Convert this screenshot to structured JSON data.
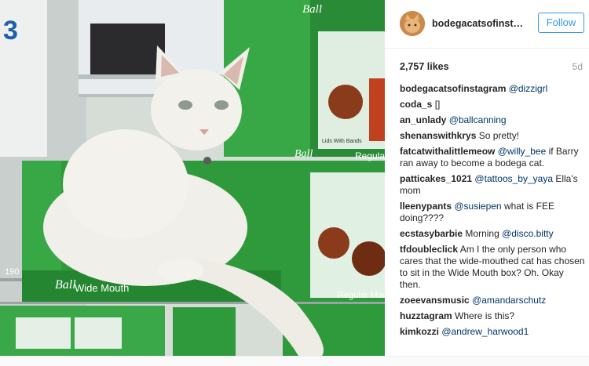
{
  "post": {
    "username": "bodegacatsofinstag...",
    "follow_label": "Follow",
    "likes": "2,757 likes",
    "time": "5d",
    "photo_text": {
      "box_brand": "Ball",
      "regular_mouth": "Regular Mouth",
      "wide_mouth": "Wide Mouth",
      "regular_short": "Regula",
      "lids_bands": "Lids With Bands",
      "price_tag": "190",
      "big_digit": "3"
    }
  },
  "comments": [
    {
      "author": "bodegacatsofinstagram",
      "mention": "@dizzigrl",
      "text": ""
    },
    {
      "author": "coda_s",
      "mention": "",
      "text": "[]"
    },
    {
      "author": "an_unlady",
      "mention": "@ballcanning",
      "text": ""
    },
    {
      "author": "shenanswithkrys",
      "mention": "",
      "text": "So pretty!"
    },
    {
      "author": "fatcatwithalittlemeow",
      "mention": "@willy_bee",
      "text": "if Barry ran away to become a bodega cat."
    },
    {
      "author": "patticakes_1021",
      "mention": "@tattoos_by_yaya",
      "text": "Ella's mom"
    },
    {
      "author": "lleenypants",
      "mention": "@susiepen",
      "text": "what is FEE doing????"
    },
    {
      "author": "ecstasybarbie",
      "mention": "",
      "text": "Morning ",
      "mention_after": "@disco.bitty"
    },
    {
      "author": "tfdoubleclick",
      "mention": "",
      "text": "Am I the only person who cares that the wide-mouthed cat has chosen to sit in the Wide Mouth box? Oh. Okay then."
    },
    {
      "author": "zoeevansmusic",
      "mention": "@amandarschutz",
      "text": ""
    },
    {
      "author": "huzztagram",
      "mention": "",
      "text": "Where is this?"
    },
    {
      "author": "kimkozzi",
      "mention": "@andrew_harwood1",
      "text": ""
    }
  ],
  "colors": {
    "accent": "#3897f0",
    "mention": "#003569",
    "box_green": "#2f9a3c",
    "cat": "#f1efe9"
  },
  "icons": {
    "avatar": "cat-avatar"
  }
}
